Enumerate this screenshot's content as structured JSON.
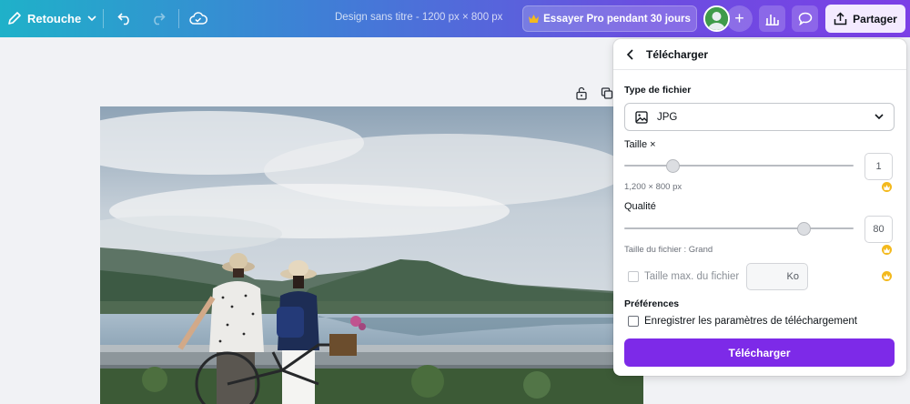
{
  "topbar": {
    "edit_label": "Retouche",
    "design_title": "Design sans titre - 1200 px × 800 px",
    "pro_label": "Essayer Pro pendant 30 jours",
    "share_label": "Partager",
    "plus_label": "+"
  },
  "download_panel": {
    "title": "Télécharger",
    "file_type_label": "Type de fichier",
    "file_type_value": "JPG",
    "size_label": "Taille ×",
    "size_value": "1",
    "size_slider_fraction": 0.21,
    "dimensions": "1,200 × 800 px",
    "quality_label": "Qualité",
    "quality_value": "80",
    "quality_slider_fraction": 0.78,
    "file_size_note": "Taille du fichier : Grand",
    "max_size_label": "Taille max. du fichier",
    "max_size_unit": "Ko",
    "preferences_label": "Préférences",
    "save_settings_label": "Enregistrer les paramètres de téléchargement",
    "download_button": "Télécharger"
  },
  "colors": {
    "download_button": "#7d2ae8",
    "crown": "#f3b91d",
    "topbar_start": "#1fb1c9",
    "topbar_end": "#7b3fe6"
  }
}
